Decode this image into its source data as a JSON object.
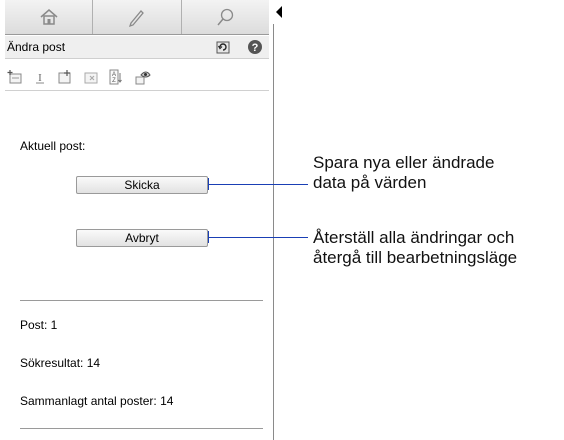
{
  "panel": {
    "tabs": [
      {
        "icon": "home-icon"
      },
      {
        "icon": "pencil-icon"
      },
      {
        "icon": "search-icon"
      }
    ],
    "title": "Ändra post",
    "title_icons": [
      "refresh-icon",
      "help-icon"
    ],
    "toolbar_icons": [
      "new-record-icon",
      "edit-field-icon",
      "add-record-icon",
      "delete-record-icon",
      "sort-icon",
      "view-icon"
    ]
  },
  "form": {
    "current_record_label": "Aktuell post:",
    "submit_label": "Skicka",
    "cancel_label": "Avbryt"
  },
  "status": {
    "record": "Post: 1",
    "search_result": "Sökresultat: 14",
    "total_records": "Sammanlagt antal poster: 14"
  },
  "annotations": {
    "submit_line1": "Spara nya eller ändrade",
    "submit_line2": "data på värden",
    "cancel_line1": "Återställ alla ändringar och",
    "cancel_line2": "återgå till bearbetningsläge"
  },
  "colors": {
    "callout": "#1a3fb5"
  }
}
